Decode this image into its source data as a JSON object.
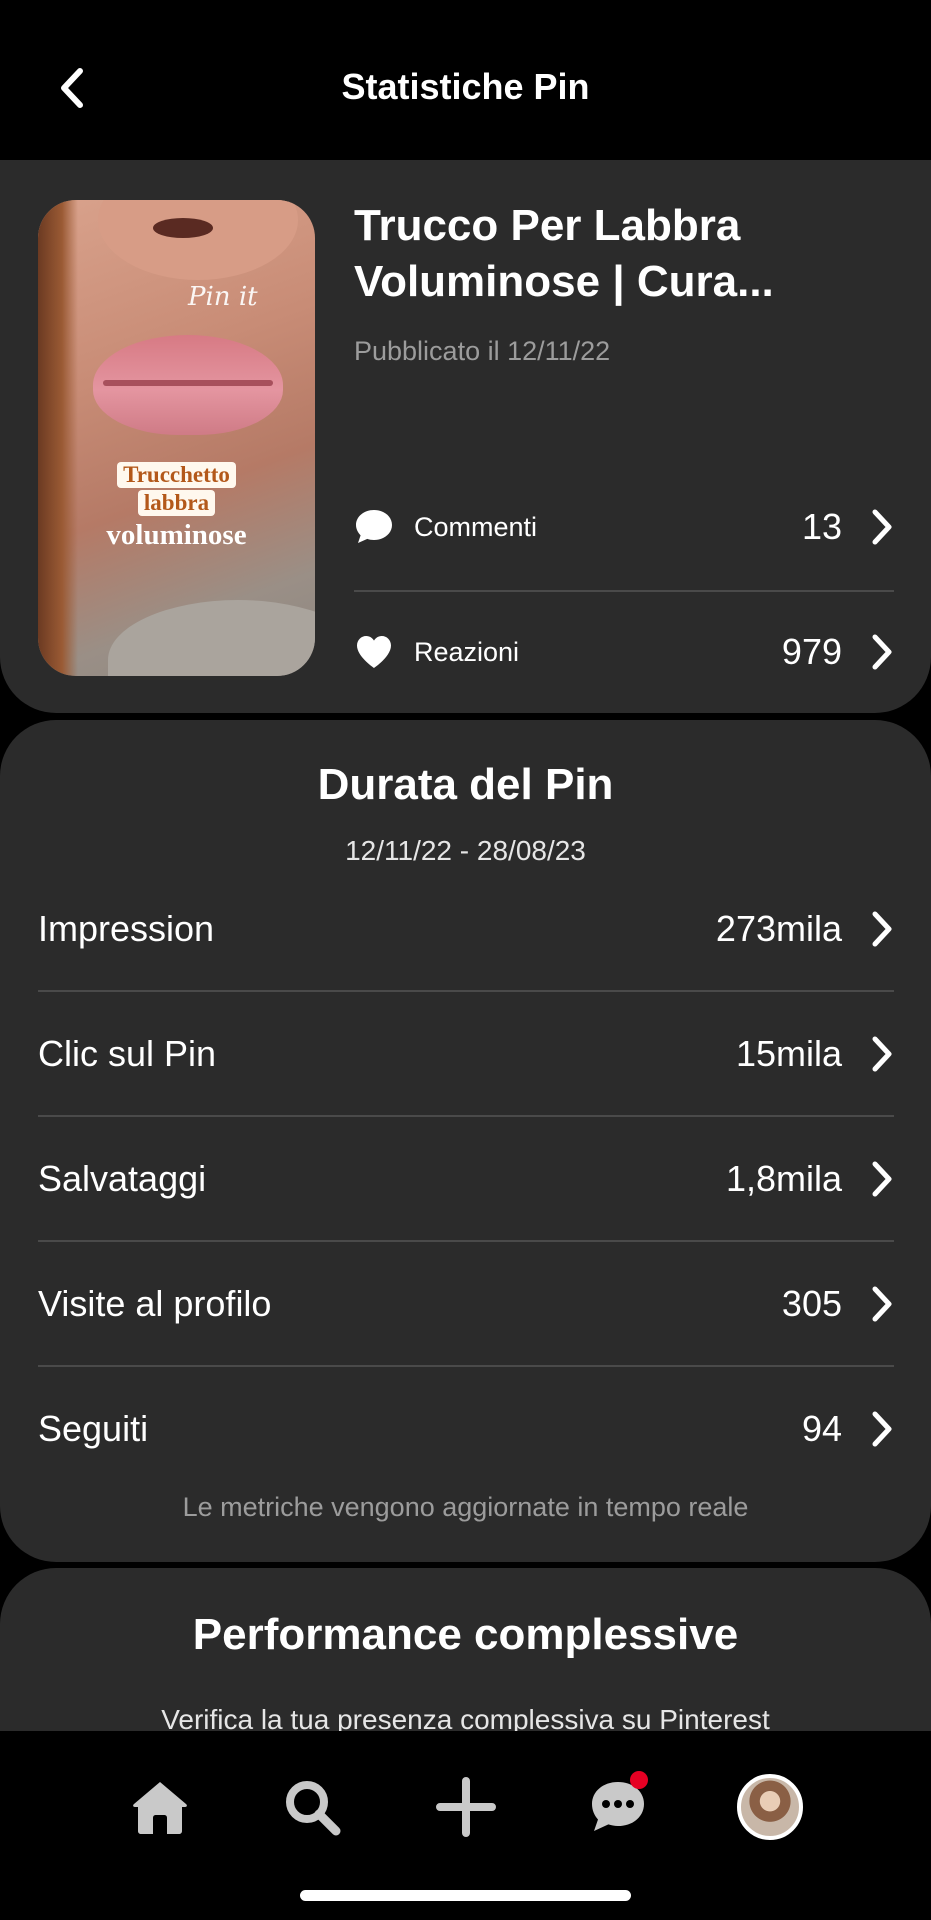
{
  "header": {
    "title": "Statistiche Pin",
    "back_icon": "chevron-left-icon"
  },
  "pin": {
    "title": "Trucco Per Labbra Voluminose | Cura...",
    "published": "Pubblicato il 12/11/22",
    "thumbnail": {
      "watermark": "Pin it",
      "overlay_line1": "Trucchetto",
      "overlay_line2": "labbra",
      "overlay_line3": "voluminose"
    },
    "metrics": [
      {
        "icon": "speech-bubble-icon",
        "label": "Commenti",
        "value": "13"
      },
      {
        "icon": "heart-icon",
        "label": "Reazioni",
        "value": "979"
      }
    ]
  },
  "lifetime": {
    "title": "Durata del Pin",
    "range": "12/11/22 - 28/08/23",
    "stats": [
      {
        "label": "Impression",
        "value": "273mila"
      },
      {
        "label": "Clic sul Pin",
        "value": "15mila"
      },
      {
        "label": "Salvataggi",
        "value": "1,8mila"
      },
      {
        "label": "Visite al profilo",
        "value": "305"
      },
      {
        "label": "Seguiti",
        "value": "94"
      }
    ],
    "footnote": "Le metriche vengono aggiornate in tempo reale"
  },
  "overall": {
    "title": "Performance complessive",
    "subtitle": "Verifica la tua presenza complessiva su Pinterest"
  },
  "tabbar": {
    "items": [
      "home-icon",
      "search-icon",
      "plus-icon",
      "messages-icon",
      "profile-avatar"
    ],
    "notification_color": "#e60023"
  },
  "colors": {
    "background": "#000000",
    "card": "#2b2b2b",
    "muted_text": "#9c9c9c",
    "divider": "#4a4a4a"
  }
}
